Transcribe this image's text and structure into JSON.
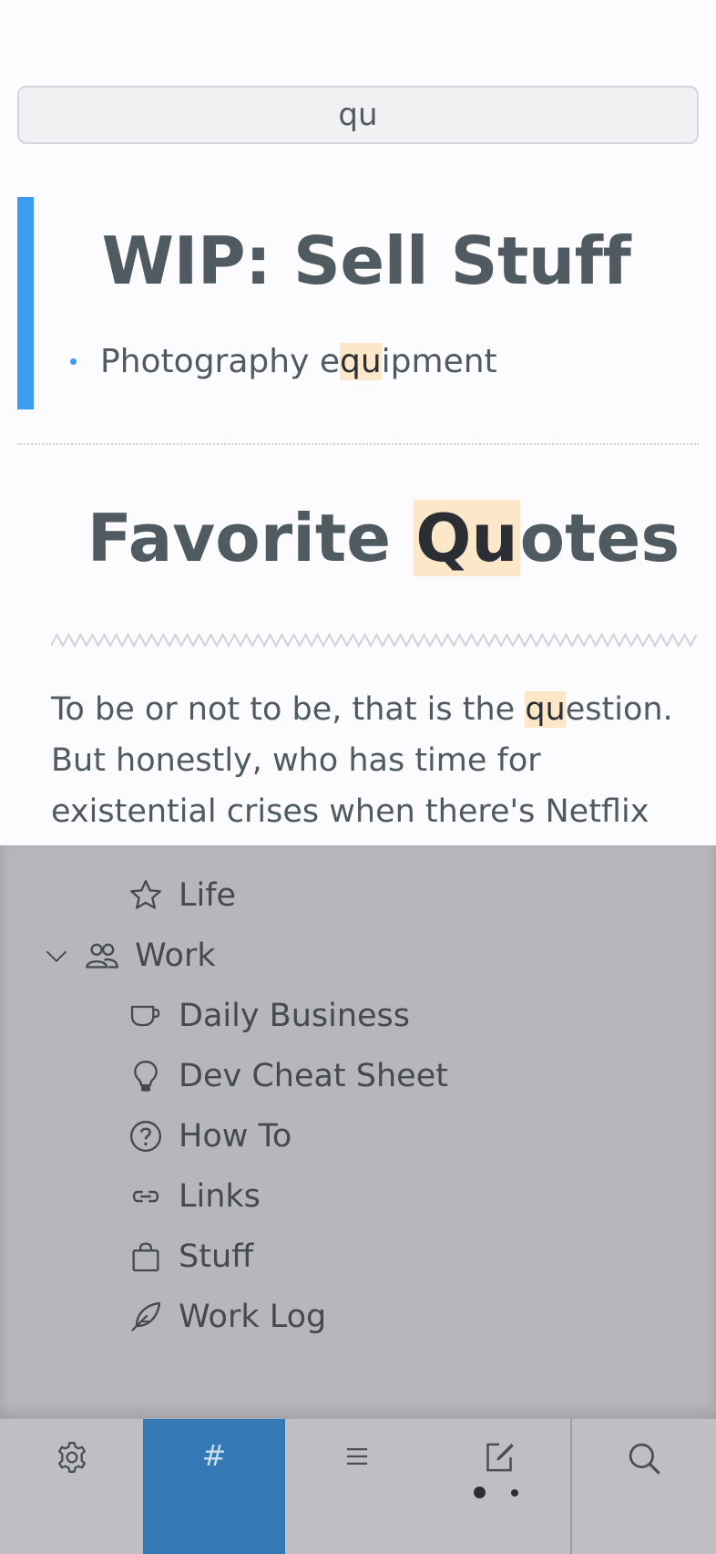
{
  "search": {
    "query": "qu"
  },
  "notes": [
    {
      "title": "WIP: Sell Stuff",
      "bullet": {
        "before": "Photography e",
        "match": "qu",
        "after": "ipment"
      }
    },
    {
      "title": {
        "before": "Favorite ",
        "match": "Qu",
        "after": "otes"
      },
      "body": {
        "before": "To be or not to be, that is the ",
        "match": "qu",
        "after": "estion. But honestly, who has time for existential crises when there's Netflix to binge-"
      }
    }
  ],
  "sidebar": {
    "items": [
      {
        "label": "Life",
        "icon": "star-icon"
      },
      {
        "label": "Work",
        "icon": "people-icon",
        "expanded": true
      },
      {
        "label": "Daily Business",
        "icon": "cup-icon"
      },
      {
        "label": "Dev Cheat Sheet",
        "icon": "lightbulb-icon"
      },
      {
        "label": "How To",
        "icon": "question-circle-icon"
      },
      {
        "label": "Links",
        "icon": "link-icon"
      },
      {
        "label": "Stuff",
        "icon": "shopping-bag-icon"
      },
      {
        "label": "Work Log",
        "icon": "feather-icon"
      }
    ]
  },
  "toolbar": {
    "tag_symbol": "#",
    "active": "tags",
    "accent_color": "#3479b6"
  },
  "colors": {
    "accent_blue": "#3b9cf0",
    "highlight": "#fde7c9",
    "overlay": "#b6b6bb"
  }
}
